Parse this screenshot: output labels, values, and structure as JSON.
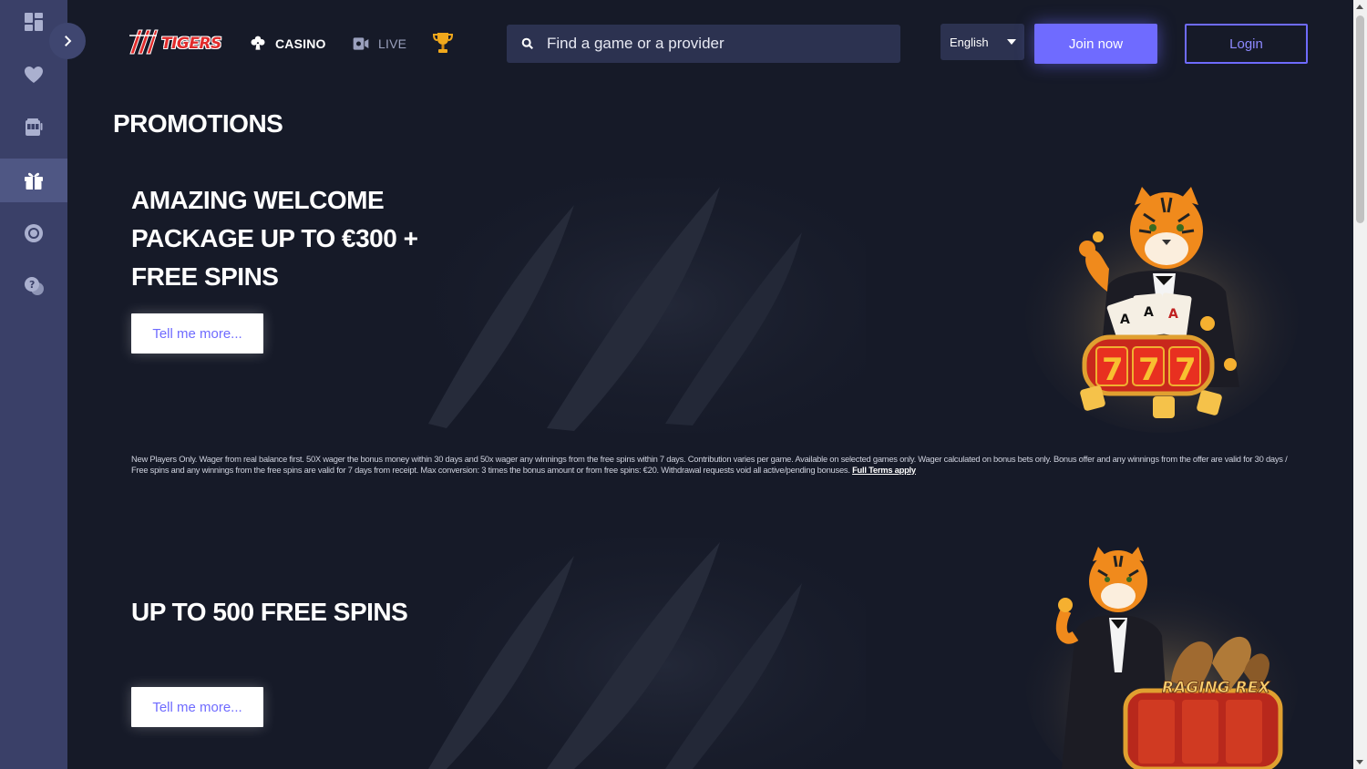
{
  "sidebar": {
    "items": [
      {
        "name": "dashboard-icon",
        "active": false
      },
      {
        "name": "heart-icon",
        "active": false
      },
      {
        "name": "slot-machine-icon",
        "active": false
      },
      {
        "name": "gift-icon",
        "active": true
      },
      {
        "name": "chip-icon",
        "active": false
      },
      {
        "name": "help-chat-icon",
        "active": false
      }
    ]
  },
  "header": {
    "logo_text": "TIGERS",
    "nav": {
      "casino": "CASINO",
      "live": "LIVE"
    },
    "search_placeholder": "Find a game or a provider",
    "language": "English",
    "join_label": "Join now",
    "login_label": "Login"
  },
  "page": {
    "title": "PROMOTIONS"
  },
  "promotions": [
    {
      "title": "AMAZING WELCOME PACKAGE UP TO €300 + FREE SPINS",
      "button": "Tell me more...",
      "terms": "New Players Only. Wager from real balance first. 50X wager the bonus money within 30 days and 50x wager any winnings from the free spins within 7 days. Contribution varies per game. Available on selected games only. Wager calculated on bonus bets only. Bonus offer and any winnings from the offer are valid for 30 days / Free spins and any winnings from the free spins are valid for 7 days from receipt. Max conversion: 3 times the bonus amount or from free spins: €20. Withdrawal requests void all active/pending bonuses.",
      "terms_link": "Full Terms apply"
    },
    {
      "title": "UP TO 500 FREE SPINS",
      "button": "Tell me more...",
      "image_label": "RAGING REX"
    }
  ],
  "colors": {
    "background": "#161a28",
    "sidebar": "#3a4068",
    "accent": "#6f6bff",
    "tiger_orange": "#f08a1c"
  }
}
